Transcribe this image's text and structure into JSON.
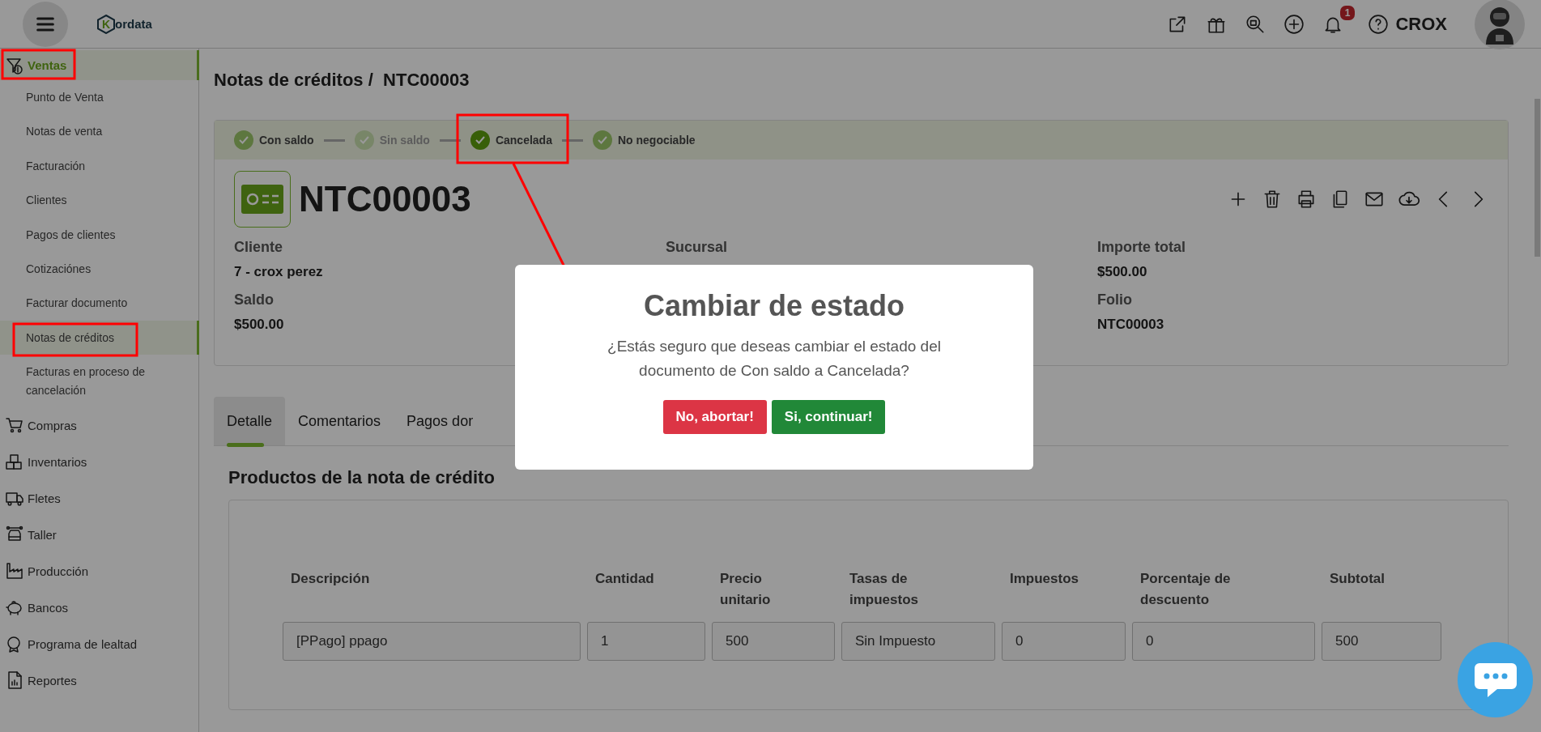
{
  "header": {
    "brand_mark": "K",
    "brand_text": "ordata",
    "notification_count": "1",
    "user_name": "CROX"
  },
  "sidebar": {
    "items": [
      {
        "label": "Ventas",
        "selected": true,
        "children": [
          {
            "label": "Punto de Venta",
            "selected": false
          },
          {
            "label": "Notas de venta",
            "selected": false
          },
          {
            "label": "Facturación",
            "selected": false
          },
          {
            "label": "Clientes",
            "selected": false
          },
          {
            "label": "Pagos de clientes",
            "selected": false
          },
          {
            "label": "Cotizaciónes",
            "selected": false
          },
          {
            "label": "Facturar documento",
            "selected": false
          },
          {
            "label": "Notas de créditos",
            "selected": true
          },
          {
            "label": "Facturas en proceso de cancelación",
            "selected": false
          }
        ]
      },
      {
        "label": "Compras",
        "selected": false
      },
      {
        "label": "Inventarios",
        "selected": false
      },
      {
        "label": "Fletes",
        "selected": false
      },
      {
        "label": "Taller",
        "selected": false
      },
      {
        "label": "Producción",
        "selected": false
      },
      {
        "label": "Bancos",
        "selected": false
      },
      {
        "label": "Programa de lealtad",
        "selected": false
      },
      {
        "label": "Reportes",
        "selected": false
      }
    ]
  },
  "breadcrumb": "Notas de créditos /  NTC00003",
  "status_steps": [
    {
      "label": "Con saldo",
      "selected": false,
      "disabled": false
    },
    {
      "label": "Sin saldo",
      "selected": false,
      "disabled": true
    },
    {
      "label": "Cancelada",
      "selected": true,
      "disabled": false
    },
    {
      "label": "No negociable",
      "selected": false,
      "disabled": false
    }
  ],
  "document": {
    "number": "NTC00003",
    "columns": [
      [
        {
          "label": "Cliente",
          "value": "7 - crox perez"
        },
        {
          "label": "Saldo",
          "value": "$500.00"
        }
      ],
      [
        {
          "label": "Sucursal"
        }
      ],
      [
        {
          "label": "Importe total",
          "value": "$500.00"
        },
        {
          "label": "Folio",
          "value": "NTC00003"
        }
      ]
    ]
  },
  "tabs": [
    {
      "label": "Detalle",
      "selected": true
    },
    {
      "label": "Comentarios",
      "selected": false
    },
    {
      "label": "Pagos dor",
      "selected": false
    }
  ],
  "section_title": "Productos de la nota de crédito",
  "table": {
    "columns": [
      "Descripción",
      "Cantidad",
      "Precio unitario",
      "Tasas de impuestos",
      "Impuestos",
      "Porcentaje de descuento",
      "Subtotal"
    ],
    "rows": [
      [
        "[PPago] ppago",
        "1",
        "500",
        "Sin Impuesto",
        "0",
        "0",
        "500"
      ]
    ]
  },
  "modal": {
    "title": "Cambiar de estado",
    "message": "¿Estás seguro que deseas cambiar el estado del documento de Con saldo a Cancelada?",
    "buttons": [
      {
        "label": "No, abortar!",
        "kind": "cancel"
      },
      {
        "label": "Si, continuar!",
        "kind": "confirm"
      }
    ]
  }
}
